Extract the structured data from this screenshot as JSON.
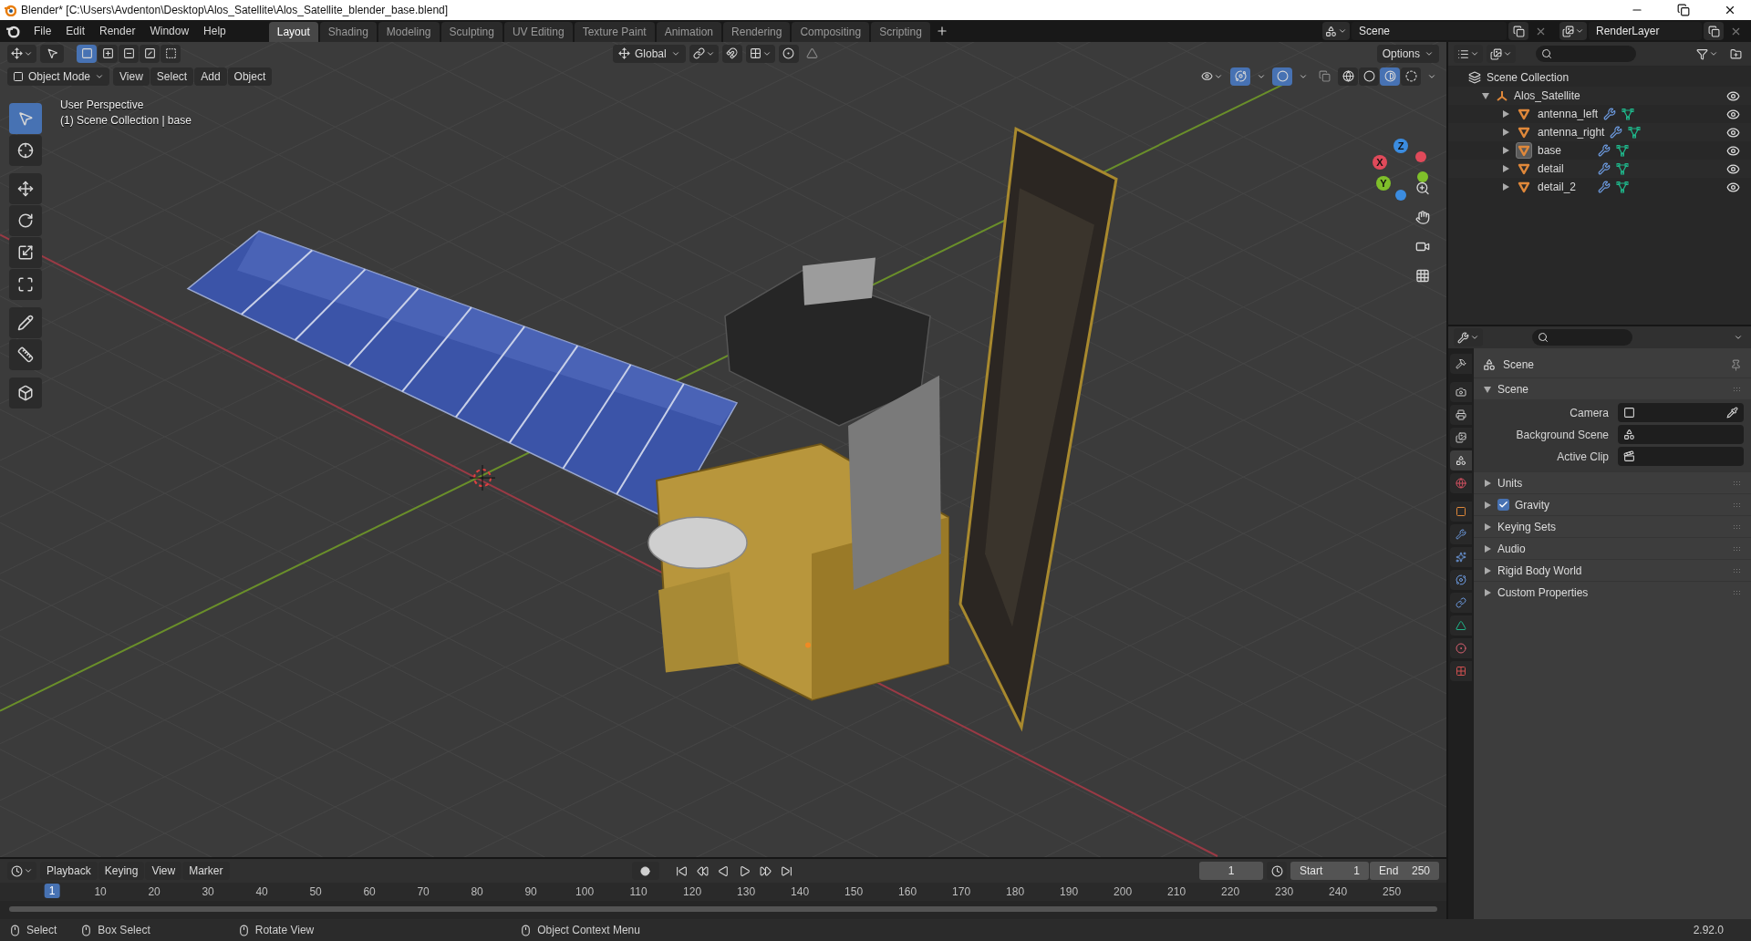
{
  "window": {
    "title": "Blender* [C:\\Users\\Avdenton\\Desktop\\Alos_Satellite\\Alos_Satellite_blender_base.blend]"
  },
  "menu": [
    "File",
    "Edit",
    "Render",
    "Window",
    "Help"
  ],
  "workspaces": [
    {
      "label": "Layout",
      "selected": true
    },
    {
      "label": "Shading",
      "selected": false
    },
    {
      "label": "Modeling",
      "selected": false
    },
    {
      "label": "Sculpting",
      "selected": false
    },
    {
      "label": "UV Editing",
      "selected": false
    },
    {
      "label": "Texture Paint",
      "selected": false
    },
    {
      "label": "Animation",
      "selected": false
    },
    {
      "label": "Rendering",
      "selected": false
    },
    {
      "label": "Compositing",
      "selected": false
    },
    {
      "label": "Scripting",
      "selected": false
    }
  ],
  "scene_selector": {
    "value": "Scene"
  },
  "view_layer_selector": {
    "value": "RenderLayer"
  },
  "tool_header": {
    "select_modes": [
      {
        "kind": "set",
        "selected": true
      },
      {
        "kind": "extend",
        "selected": false
      },
      {
        "kind": "subtract",
        "selected": false
      },
      {
        "kind": "difference",
        "selected": false
      },
      {
        "kind": "intersect",
        "selected": false
      }
    ],
    "orientation": "Global",
    "options": "Options"
  },
  "viewport_header": {
    "mode": "Object Mode",
    "menus": [
      "View",
      "Select",
      "Add",
      "Object"
    ],
    "shading": [
      {
        "kind": "wireframe",
        "selected": false
      },
      {
        "kind": "solid",
        "selected": false
      },
      {
        "kind": "material",
        "selected": true
      },
      {
        "kind": "rendered",
        "selected": false
      }
    ]
  },
  "viewport": {
    "info": [
      "User Perspective",
      "(1) Scene Collection | base"
    ],
    "tools": [
      {
        "kind": "select",
        "selected": true
      },
      {
        "kind": "cursor",
        "selected": false
      },
      {
        "kind": "move",
        "selected": false
      },
      {
        "kind": "rotate",
        "selected": false
      },
      {
        "kind": "scale",
        "selected": false
      },
      {
        "kind": "transform",
        "selected": false
      },
      {
        "kind": "annotate",
        "selected": false
      },
      {
        "kind": "measure",
        "selected": false
      },
      {
        "kind": "add_cube",
        "selected": false
      }
    ],
    "gizmo_axes": [
      "X",
      "Y",
      "Z"
    ]
  },
  "outliner": {
    "root": "Scene Collection",
    "items": [
      {
        "name": "Alos_Satellite",
        "expanded": true,
        "children": [
          {
            "name": "antenna_left",
            "selected": false
          },
          {
            "name": "antenna_right",
            "selected": false
          },
          {
            "name": "base",
            "selected": true
          },
          {
            "name": "detail",
            "selected": false
          },
          {
            "name": "detail_2",
            "selected": false
          }
        ]
      }
    ]
  },
  "properties": {
    "tabs": [
      {
        "kind": "tool",
        "selected": false
      },
      {
        "kind": "render",
        "selected": false
      },
      {
        "kind": "output",
        "selected": false
      },
      {
        "kind": "view_layer",
        "selected": false
      },
      {
        "kind": "scene",
        "selected": true
      },
      {
        "kind": "world",
        "selected": false
      },
      {
        "kind": "object",
        "selected": false
      },
      {
        "kind": "modifiers",
        "selected": false
      },
      {
        "kind": "particles",
        "selected": false
      },
      {
        "kind": "physics",
        "selected": false
      },
      {
        "kind": "constraints",
        "selected": false
      },
      {
        "kind": "data",
        "selected": false
      },
      {
        "kind": "material",
        "selected": false
      },
      {
        "kind": "texture",
        "selected": false
      }
    ],
    "context": "Scene",
    "sections": [
      {
        "title": "Scene",
        "expanded": true,
        "fields": [
          {
            "label": "Camera",
            "kind": "camera"
          },
          {
            "label": "Background Scene",
            "kind": "scene"
          },
          {
            "label": "Active Clip",
            "kind": "clip"
          }
        ]
      },
      {
        "title": "Units",
        "expanded": false
      },
      {
        "title": "Gravity",
        "expanded": false,
        "toggle": {
          "checked": true
        }
      },
      {
        "title": "Keying Sets",
        "expanded": false
      },
      {
        "title": "Audio",
        "expanded": false
      },
      {
        "title": "Rigid Body World",
        "expanded": false
      },
      {
        "title": "Custom Properties",
        "expanded": false
      }
    ]
  },
  "timeline": {
    "menus": [
      "Playback",
      "Keying",
      "View",
      "Marker"
    ],
    "current_frame": "1",
    "start_label": "Start",
    "start": "1",
    "end_label": "End",
    "end": "250",
    "playhead": "1",
    "ruler": [
      "10",
      "20",
      "30",
      "40",
      "50",
      "60",
      "70",
      "80",
      "90",
      "100",
      "110",
      "120",
      "130",
      "140",
      "150",
      "160",
      "170",
      "180",
      "190",
      "200",
      "210",
      "220",
      "230",
      "240",
      "250"
    ]
  },
  "status_bar": {
    "hints": [
      "Select",
      "Box Select",
      "Rotate View",
      "Object Context Menu"
    ],
    "version": "2.92.0"
  }
}
